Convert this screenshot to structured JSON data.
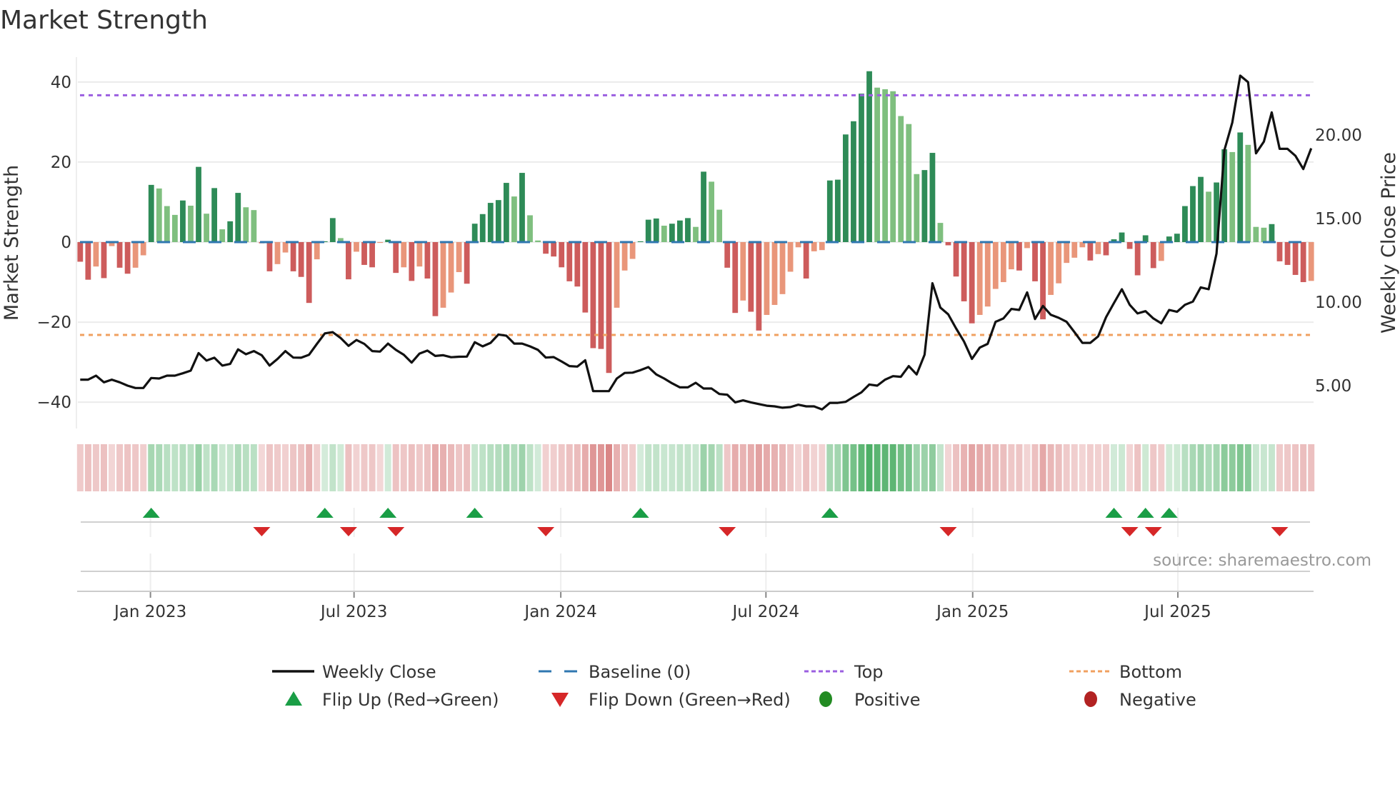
{
  "chart_data": {
    "type": "bar",
    "title": "Market Strength",
    "ylabel": "Market Strength",
    "y2label": "Weekly Close Price",
    "ylim": [
      -46.4,
      46.4
    ],
    "y2lim": [
      2.48,
      24.7
    ],
    "xlim": [
      -0.3,
      156.3
    ],
    "yticks": [
      {
        "v": 40,
        "label": "40"
      },
      {
        "v": 20,
        "label": "20"
      },
      {
        "v": 0,
        "label": "0"
      },
      {
        "v": -20,
        "label": "−20"
      },
      {
        "v": -40,
        "label": "−40"
      }
    ],
    "y2ticks": [
      {
        "v": 20,
        "label": "20.00"
      },
      {
        "v": 15,
        "label": "15.00"
      },
      {
        "v": 10,
        "label": "10.00"
      },
      {
        "v": 5,
        "label": "5.00"
      }
    ],
    "xticks": [
      {
        "week": 8.9,
        "label": "Jan 2023"
      },
      {
        "week": 34.7,
        "label": "Jul 2023"
      },
      {
        "week": 60.9,
        "label": "Jan 2024"
      },
      {
        "week": 86.9,
        "label": "Jul 2024"
      },
      {
        "week": 113.1,
        "label": "Jan 2025"
      },
      {
        "week": 139.1,
        "label": "Jul 2025"
      }
    ],
    "top_level": 36.7,
    "bottom_level": -23.2,
    "baseline": 0,
    "grid": true,
    "series": [
      {
        "name": "Market Strength",
        "type": "bar",
        "values": [
          -4.9,
          -9.4,
          -6.1,
          -9,
          -1,
          -6.4,
          -7.9,
          -6.4,
          -3.3,
          14.3,
          13.4,
          9,
          6.8,
          10.4,
          9.1,
          18.8,
          7.1,
          13.5,
          3.2,
          5.2,
          12.3,
          8.7,
          8,
          -0.3,
          -7.3,
          -5.5,
          -2.6,
          -7.3,
          -8.7,
          -15.2,
          -4.3,
          0.2,
          6,
          1,
          -9.3,
          -2.4,
          -5.7,
          -6.3,
          -0.2,
          0.6,
          -7.7,
          -6.3,
          -9.7,
          -6.1,
          -9.1,
          -18.5,
          -16.4,
          -12.6,
          -7.5,
          -10.4,
          4.6,
          7,
          9.8,
          10.5,
          14.8,
          11.4,
          17.3,
          6.7,
          0.4,
          -2.9,
          -3.6,
          -6.3,
          -9.8,
          -11.1,
          -17.6,
          -26.5,
          -26.7,
          -32.7,
          -16.4,
          -7.1,
          -4.2,
          0.2,
          5.6,
          5.9,
          4.1,
          4.6,
          5.4,
          6,
          3.8,
          17.6,
          15.1,
          8.1,
          -6.4,
          -17.7,
          -14.6,
          -17.4,
          -22.1,
          -18.2,
          -15.7,
          -13,
          -7.4,
          -1.3,
          -9.1,
          -2.3,
          -2,
          15.4,
          15.6,
          26.9,
          30.2,
          37.1,
          42.7,
          38.6,
          38.2,
          37.7,
          31.5,
          29.5,
          17,
          18,
          22.3,
          4.8,
          -0.8,
          -8.6,
          -14.8,
          -20.3,
          -18.2,
          -16.1,
          -11.7,
          -10,
          -6.8,
          -7.1,
          -1.5,
          -9.8,
          -19.3,
          -13.2,
          -10.3,
          -5.2,
          -3.9,
          -1.3,
          -4.6,
          -3,
          -3.3,
          0.7,
          2.4,
          -1.7,
          -8.3,
          1.7,
          -6.5,
          -4.7,
          1.4,
          2.1,
          9,
          14,
          16.3,
          12.6,
          14.9,
          23.2,
          22.5,
          27.4,
          24.3,
          3.8,
          3.6,
          4.5,
          -4.8,
          -5.7,
          -8.2,
          -10,
          -9.7
        ]
      },
      {
        "name": "Weekly Close",
        "type": "line",
        "axis": "right",
        "values": [
          5.36,
          5.36,
          5.6,
          5.2,
          5.36,
          5.2,
          5.0,
          4.86,
          4.86,
          5.46,
          5.43,
          5.6,
          5.6,
          5.74,
          5.9,
          6.95,
          6.5,
          6.67,
          6.2,
          6.3,
          7.17,
          6.88,
          7.07,
          6.82,
          6.2,
          6.6,
          7.07,
          6.68,
          6.67,
          6.85,
          7.5,
          8.13,
          8.2,
          7.85,
          7.38,
          7.73,
          7.5,
          7.07,
          7.04,
          7.52,
          7.14,
          6.85,
          6.38,
          6.92,
          7.1,
          6.78,
          6.82,
          6.7,
          6.73,
          6.74,
          7.6,
          7.35,
          7.56,
          8.06,
          7.99,
          7.52,
          7.52,
          7.35,
          7.14,
          6.68,
          6.71,
          6.45,
          6.17,
          6.14,
          6.52,
          4.67,
          4.67,
          4.67,
          5.43,
          5.76,
          5.78,
          5.93,
          6.11,
          5.67,
          5.43,
          5.14,
          4.9,
          4.9,
          5.17,
          4.83,
          4.83,
          4.5,
          4.46,
          4.0,
          4.12,
          4.0,
          3.9,
          3.8,
          3.76,
          3.68,
          3.72,
          3.86,
          3.76,
          3.76,
          3.58,
          3.97,
          3.97,
          4.03,
          4.32,
          4.6,
          5.07,
          5.0,
          5.36,
          5.57,
          5.53,
          6.17,
          5.67,
          6.85,
          11.13,
          9.67,
          9.27,
          8.42,
          7.64,
          6.6,
          7.28,
          7.5,
          8.82,
          9.02,
          9.59,
          9.53,
          10.58,
          8.99,
          9.77,
          9.24,
          9.06,
          8.82,
          8.2,
          7.56,
          7.56,
          7.95,
          9.1,
          9.94,
          10.77,
          9.84,
          9.32,
          9.46,
          9.02,
          8.73,
          9.53,
          9.42,
          9.84,
          10.03,
          10.88,
          10.77,
          12.9,
          19.1,
          20.74,
          23.55,
          23.16,
          18.9,
          19.6,
          21.35,
          19.17,
          19.17,
          18.75,
          17.96,
          19.2
        ]
      }
    ],
    "flips_up": [
      9,
      31,
      39,
      50,
      71,
      95,
      131,
      135,
      138
    ],
    "flips_down": [
      23,
      34,
      40,
      59,
      82,
      110,
      133,
      136,
      152
    ],
    "legend": [
      {
        "label": "Weekly Close",
        "kind": "line"
      },
      {
        "label": "Baseline (0)",
        "kind": "dash"
      },
      {
        "label": "Top",
        "kind": "dot-top"
      },
      {
        "label": "Bottom",
        "kind": "dot-bottom"
      },
      {
        "label": "Flip Up (Red→Green)",
        "kind": "tri-up"
      },
      {
        "label": "Flip Down (Green→Red)",
        "kind": "tri-down"
      },
      {
        "label": "Positive",
        "kind": "circle-pos"
      },
      {
        "label": "Negative",
        "kind": "circle-neg"
      }
    ],
    "legend_placement": "bottom",
    "source": "source: sharemaestro.com"
  },
  "colors": {
    "green_strong": "#2e8b57",
    "green_weak": "#7fbf7f",
    "red_strong": "#cd5c5c",
    "red_weak": "#e9967a",
    "baseline": "#2f77b0",
    "top": "#9b5fe0",
    "bottom": "#f0a060",
    "flip_up": "#1a9e46",
    "flip_down": "#d62728",
    "positive": "#228b22",
    "negative": "#b22222",
    "line": "#111111"
  }
}
